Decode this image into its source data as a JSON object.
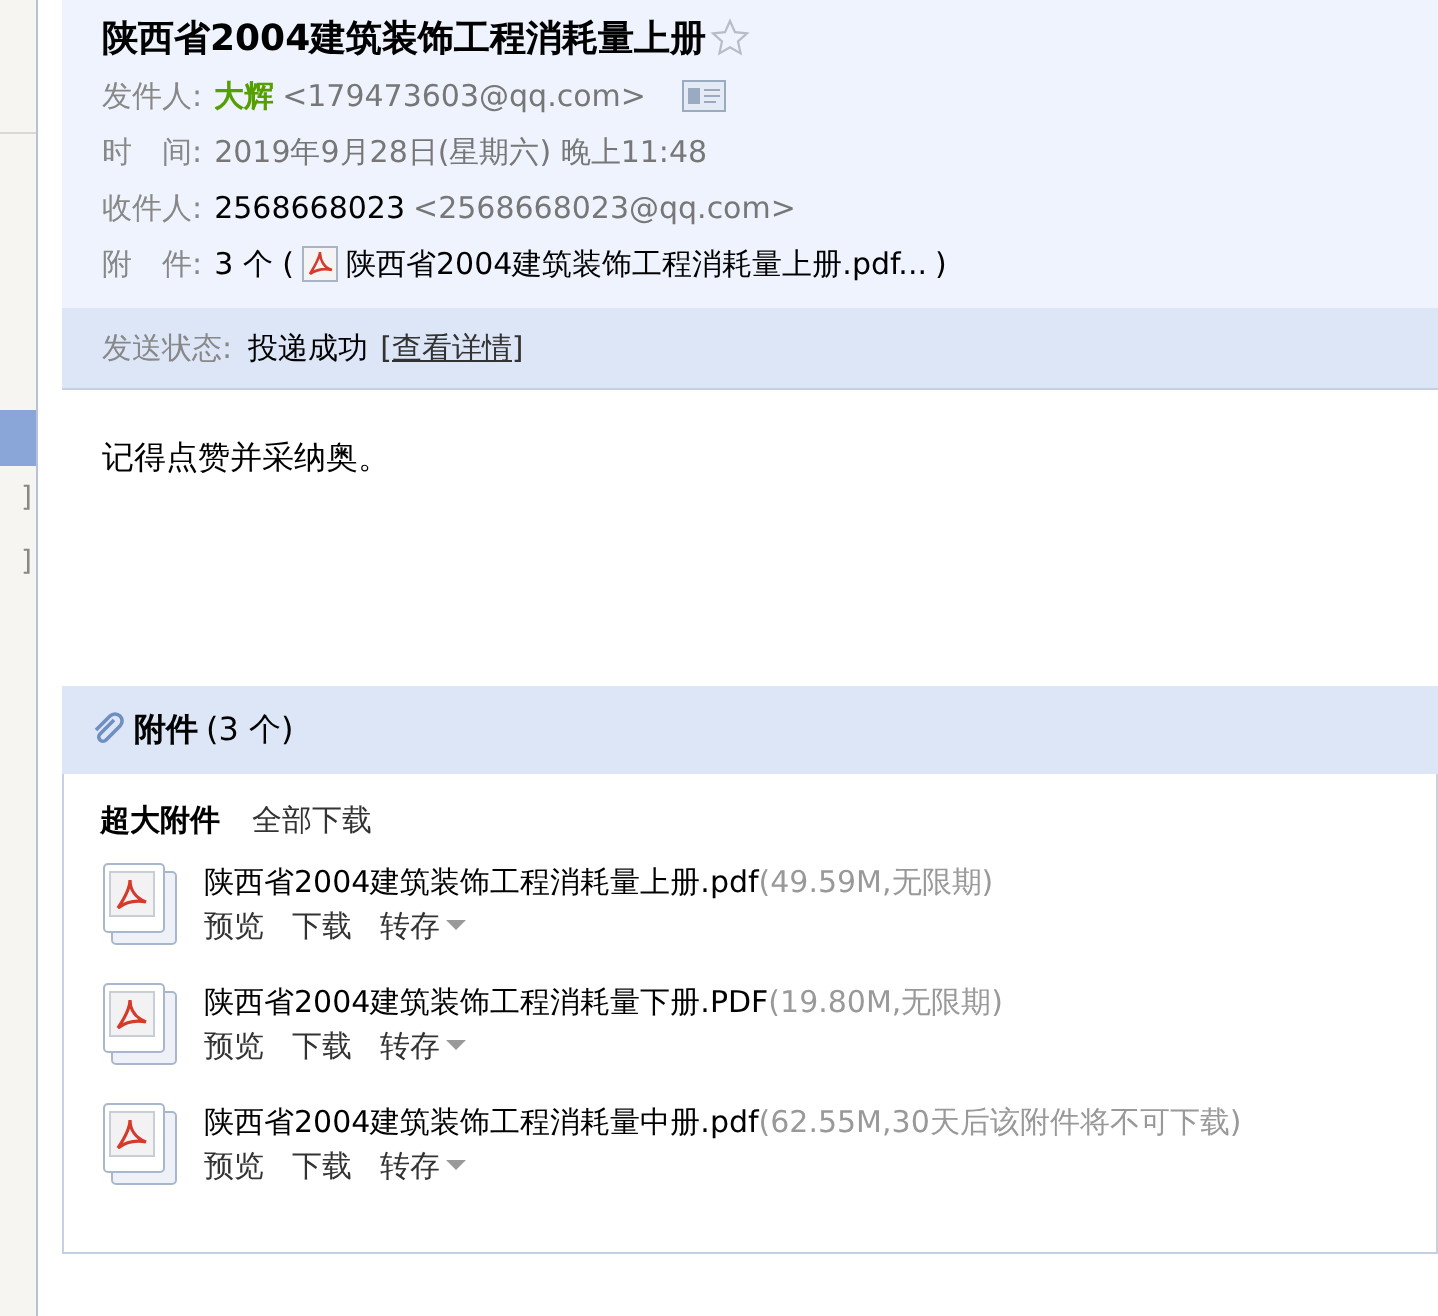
{
  "sidebar": {
    "items": [
      {
        "text": "]",
        "selected": false
      },
      {
        "text": "]",
        "selected": false
      }
    ],
    "highlight": {
      "selected": true
    }
  },
  "mail": {
    "subject": "陕西省2004建筑装饰工程消耗量上册",
    "starred": false,
    "meta": [
      {
        "kind": "sender",
        "label": "发件人:",
        "name": "大辉",
        "value": "<179473603@qq.com>"
      },
      {
        "kind": "plain",
        "label": "时　间:",
        "value": "2019年9月28日(星期六) 晚上11:48"
      },
      {
        "kind": "recipient",
        "label": "收件人:",
        "name": "2568668023",
        "value": "<2568668023@qq.com>"
      },
      {
        "kind": "attachment",
        "label": "附　件:",
        "count": "3 个 (",
        "file": "陕西省2004建筑装饰工程消耗量上册.pdf...",
        "close": ")"
      }
    ],
    "status": {
      "label": "发送状态:",
      "value": "投递成功",
      "link": "[查看详情]"
    },
    "body": "记得点赞并采纳奥。"
  },
  "attachments": {
    "title": "附件",
    "count": "(3 个)",
    "section": "超大附件",
    "download_all": "全部下载",
    "files": [
      {
        "name": "陕西省2004建筑装饰工程消耗量上册.pdf",
        "info": "(49.59M,无限期)",
        "actions": [
          "预览",
          "下载",
          "转存"
        ]
      },
      {
        "name": "陕西省2004建筑装饰工程消耗量下册.PDF",
        "info": "(19.80M,无限期)",
        "actions": [
          "预览",
          "下载",
          "转存"
        ]
      },
      {
        "name": "陕西省2004建筑装饰工程消耗量中册.pdf",
        "info": "(62.55M,30天后该附件将不可下载)",
        "actions": [
          "预览",
          "下载",
          "转存"
        ]
      }
    ]
  }
}
